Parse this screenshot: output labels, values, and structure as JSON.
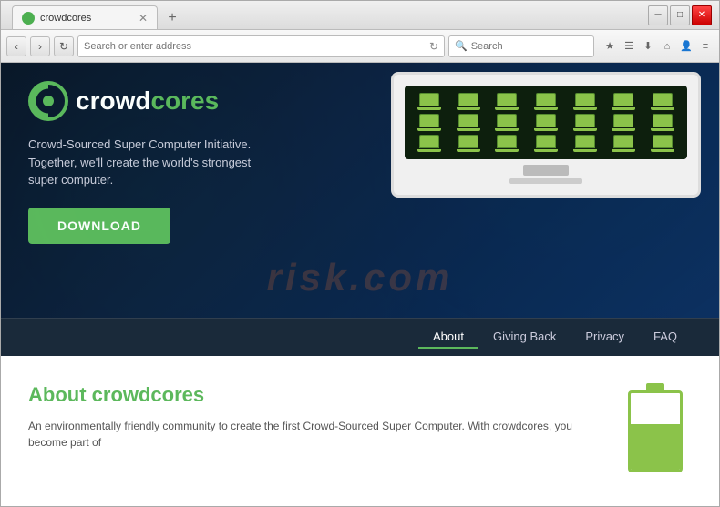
{
  "browser": {
    "tab_title": "crowdcores",
    "address": "Search or enter address",
    "search_placeholder": "Search",
    "new_tab_label": "+",
    "nav_back": "‹",
    "nav_forward": "›",
    "refresh": "↻"
  },
  "window_controls": {
    "minimize": "─",
    "maximize": "□",
    "close": "✕"
  },
  "nav_icons": [
    "★",
    "🔒",
    "⬇",
    "⌂",
    "👤",
    "≡"
  ],
  "hero": {
    "logo_crowd": "crowd",
    "logo_cores": "cores",
    "tagline_line1": "Crowd-Sourced Super Computer Initiative.",
    "tagline_line2": "Together, we'll create the world's strongest",
    "tagline_line3": "super computer.",
    "download_btn": "DOWNLOAD",
    "nav_items": [
      {
        "label": "About",
        "active": true
      },
      {
        "label": "Giving Back",
        "active": false
      },
      {
        "label": "Privacy",
        "active": false
      },
      {
        "label": "FAQ",
        "active": false
      }
    ]
  },
  "about": {
    "title": "About crowdcores",
    "description": "An environmentally friendly community to create the first Crowd-Sourced Super Computer. With crowdcores, you become part of"
  },
  "watermark": "risk.com"
}
